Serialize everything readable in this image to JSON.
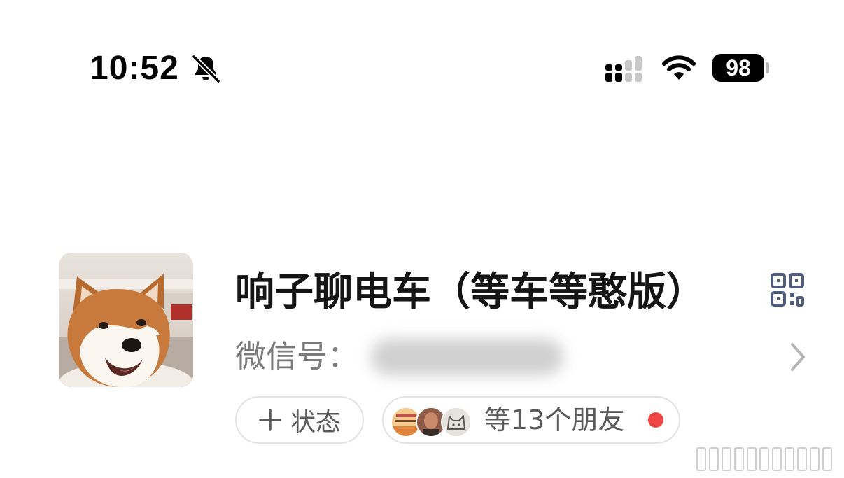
{
  "status_bar": {
    "time": "10:52",
    "battery": "98",
    "icons": [
      "bell-off-icon",
      "cellular-signal-icon",
      "wifi-icon",
      "battery-icon"
    ]
  },
  "profile": {
    "avatar_icon": "shiba-inu-avatar",
    "nickname": "响子聊电车（等车等憨版）",
    "wechat_id_label": "微信号：",
    "qr_icon": "qr-code-icon",
    "chevron_icon": "chevron-right-icon"
  },
  "chips": {
    "status": {
      "label": "状态",
      "icon": "plus-icon"
    },
    "friends": {
      "label": "等13个朋友",
      "dot_color": "#ee4646"
    }
  },
  "colors": {
    "text_primary": "#151515",
    "text_secondary": "#7b7b7b",
    "chip_border": "#e2e2e2",
    "qr_icon": "#4f5c7c"
  }
}
